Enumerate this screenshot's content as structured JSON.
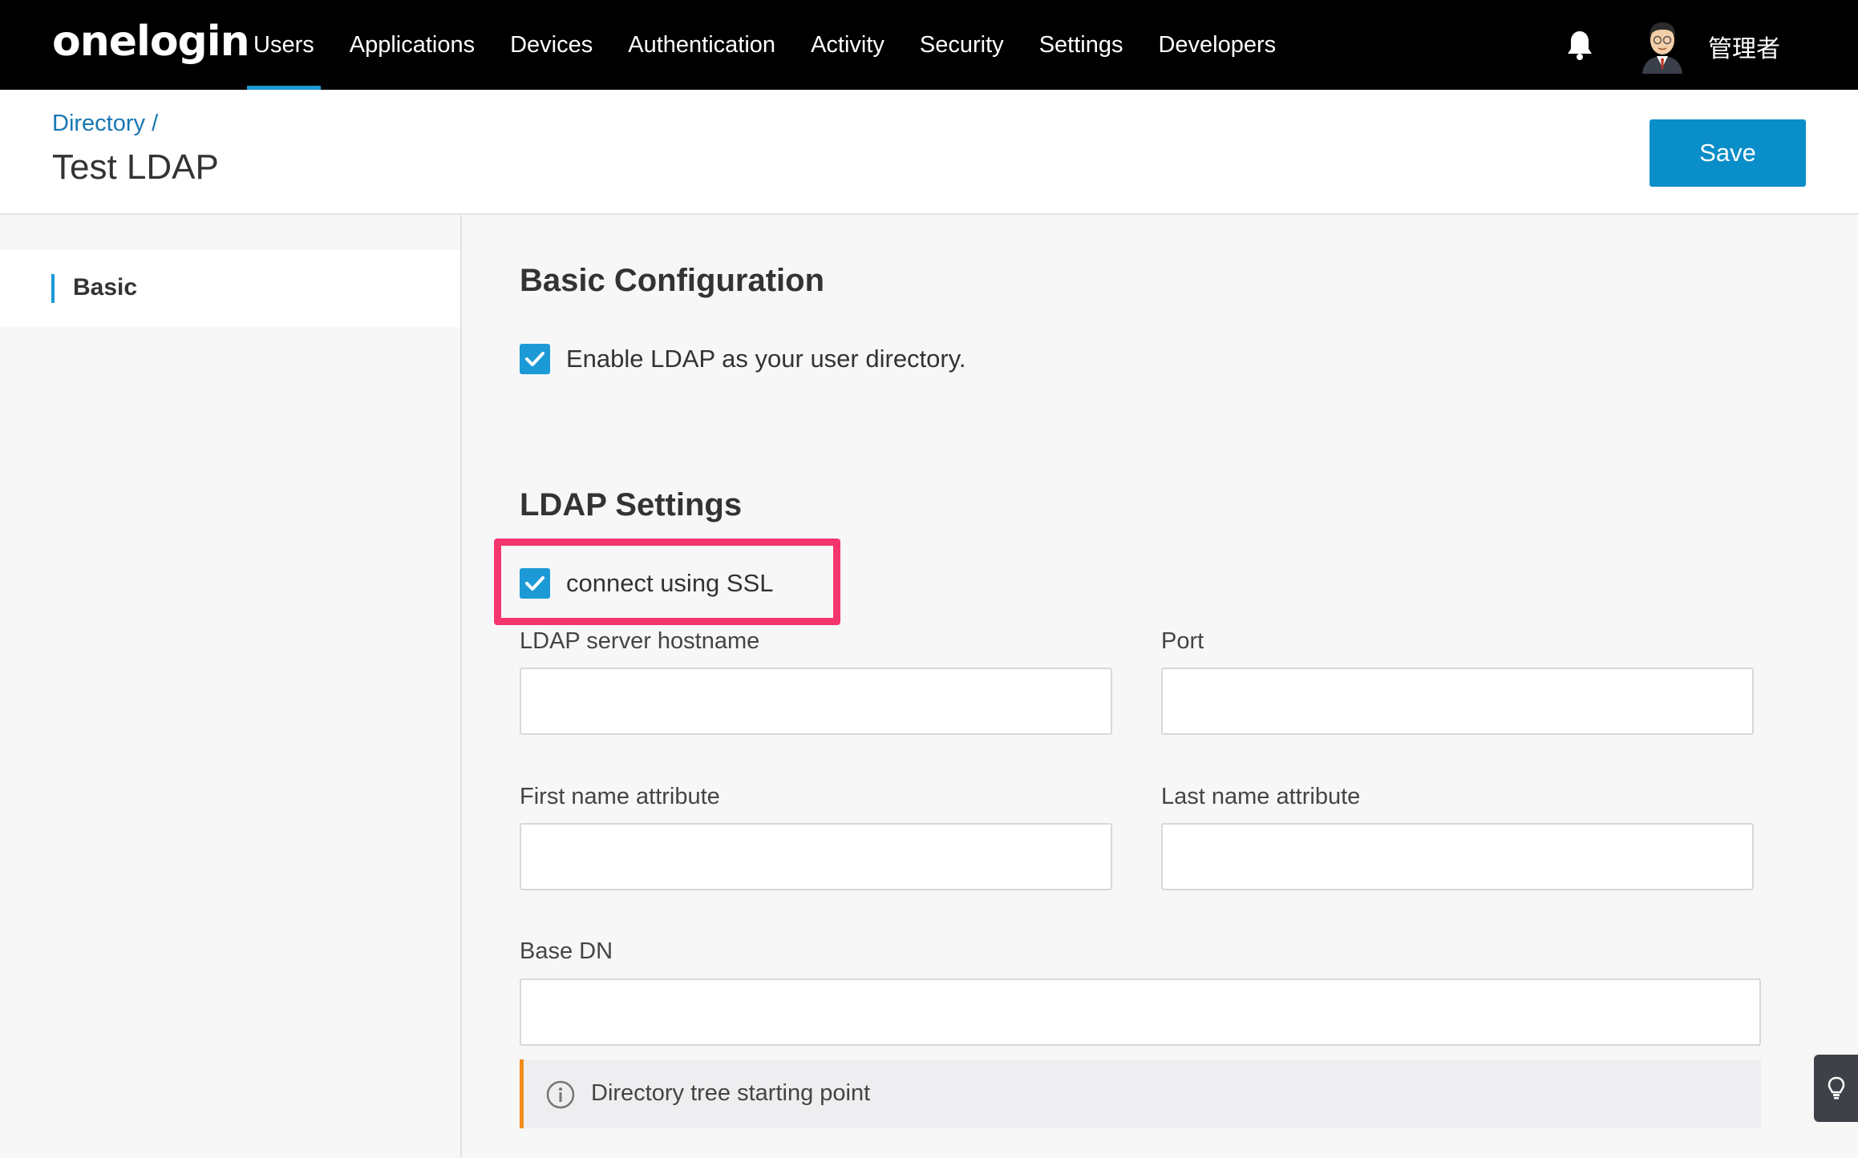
{
  "brand": {
    "logo_text": "onelogin",
    "accent": "#1c9ad6",
    "save_color": "#0a8ec9",
    "highlight": "#f5356d",
    "hint_accent": "#f08c1c"
  },
  "nav": {
    "items": [
      {
        "label": "Users",
        "active": true
      },
      {
        "label": "Applications"
      },
      {
        "label": "Devices"
      },
      {
        "label": "Authentication"
      },
      {
        "label": "Activity"
      },
      {
        "label": "Security"
      },
      {
        "label": "Settings"
      },
      {
        "label": "Developers"
      }
    ],
    "notification_icon": "bell-icon",
    "user_name": "管理者"
  },
  "header": {
    "breadcrumb": "Directory /",
    "title": "Test LDAP",
    "save_label": "Save"
  },
  "sidebar": {
    "items": [
      {
        "label": "Basic",
        "active": true
      }
    ]
  },
  "main": {
    "basic_config": {
      "heading": "Basic Configuration",
      "enable_ldap_label": "Enable LDAP as your user directory.",
      "enable_ldap_checked": true
    },
    "ldap_settings": {
      "heading": "LDAP Settings",
      "ssl_label": "connect using SSL",
      "ssl_checked": true,
      "hostname_label": "LDAP server hostname",
      "hostname_value": "",
      "port_label": "Port",
      "port_value": "",
      "first_name_label": "First name attribute",
      "first_name_value": "",
      "last_name_label": "Last name attribute",
      "last_name_value": "",
      "base_dn_label": "Base DN",
      "base_dn_value": "",
      "base_dn_hint": "Directory tree starting point"
    }
  },
  "help_icon": "lightbulb-icon"
}
